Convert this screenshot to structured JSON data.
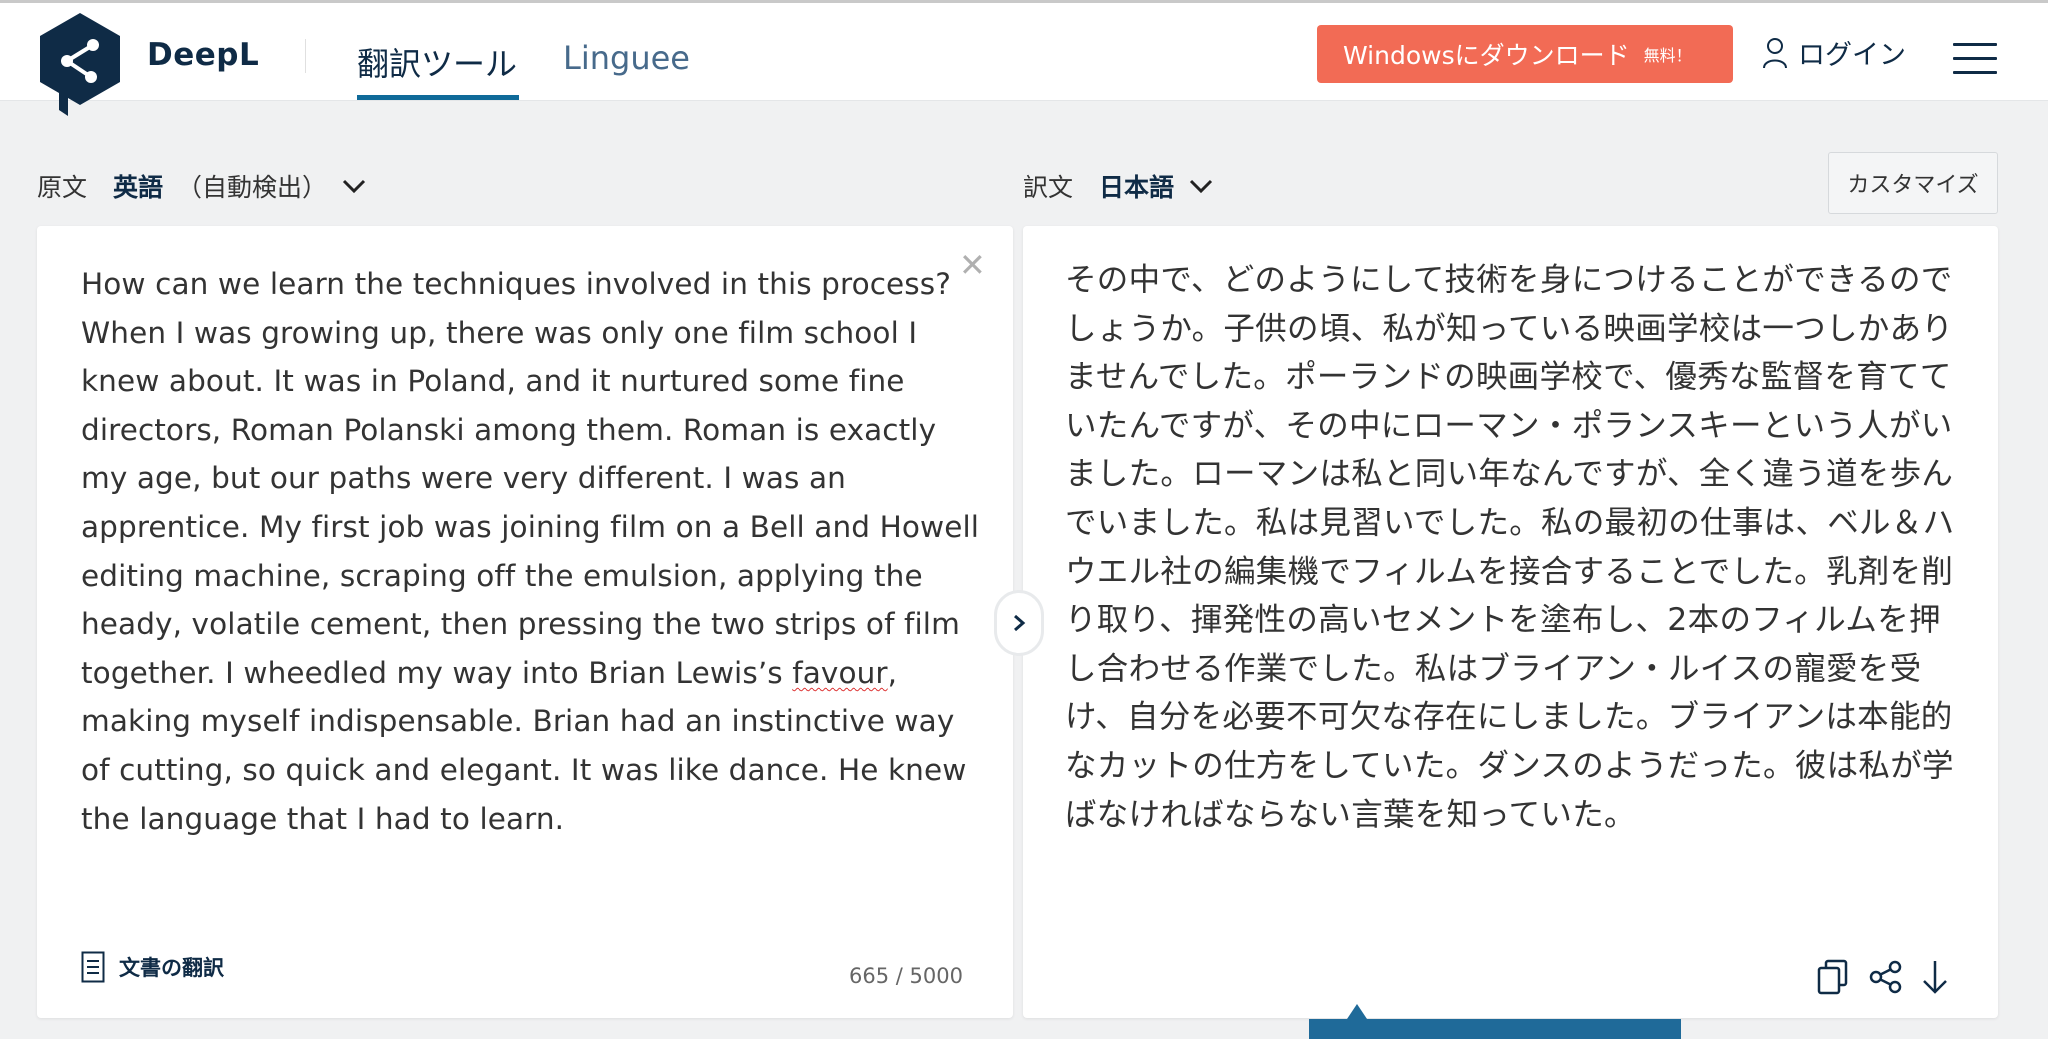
{
  "header": {
    "brand": "DeepL",
    "tabs": [
      {
        "label": "翻訳ツール",
        "active": true
      },
      {
        "label": "Linguee",
        "active": false
      }
    ],
    "download_button": "Windowsにダウンロード",
    "download_free": "無料！",
    "login": "ログイン"
  },
  "source": {
    "label": "原文",
    "language": "英語",
    "auto_detect": "（自動検出）",
    "text_part1": "How can we learn the techniques involved in this process? When I was growing up, there was only one film school I knew about. It was in Poland, and it nurtured some fine directors, Roman Polanski among them. Roman is exactly my age, but our paths were very different. I was an apprentice. My first job was joining film on a Bell and Howell editing machine, scraping off the emulsion, applying the heady, volatile cement, then pressing the two strips of film together. I wheedled my way into Brian Lewis’s ",
    "text_misspelled": "favour",
    "text_part2": ", making myself indispensable. Brian had an instinctive way of cutting, so quick and elegant. It was like dance. He knew the language that I had to learn.",
    "doc_translate": "文書の翻訳",
    "char_count": "665 / 5000"
  },
  "target": {
    "label": "訳文",
    "language": "日本語",
    "customize": "カスタマイズ",
    "text": "その中で、どのようにして技術を身につけることができるのでしょうか。子供の頃、私が知っている映画学校は一つしかありませんでした。ポーランドの映画学校で、優秀な監督を育てていたんですが、その中にローマン・ポランスキーという人がいました。ローマンは私と同い年なんですが、全く違う道を歩んでいました。私は見習いでした。私の最初の仕事は、ベル＆ハウエル社の編集機でフィルムを接合することでした。乳剤を削り取り、揮発性の高いセメントを塗布し、2本のフィルムを押し合わせる作業でした。私はブライアン・ルイスの寵愛を受け、自分を必要不可欠な存在にしました。ブライアンは本能的なカットの仕方をしていた。ダンスのようだった。彼は私が学ばなければならない言葉を知っていた。"
  },
  "icons": {
    "logo": "deepl-logo",
    "user": "user-icon",
    "menu": "hamburger-menu-icon",
    "chevron": "chevron-down-icon",
    "clear": "close-icon",
    "document": "document-icon",
    "toggle": "chevron-right-icon",
    "copy": "copy-icon",
    "share": "share-icon",
    "download": "download-icon"
  },
  "colors": {
    "brand_navy": "#0f2b46",
    "accent_blue": "#0f6a99",
    "download_button": "#f26b55",
    "background": "#f0f1f2"
  }
}
